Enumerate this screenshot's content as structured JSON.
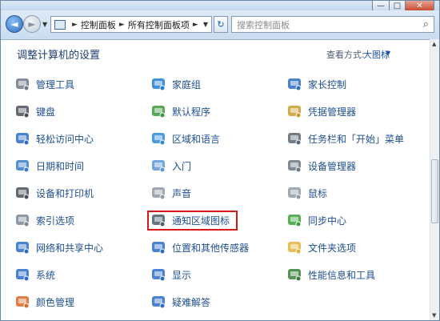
{
  "window": {
    "controls": {
      "minimize": "—",
      "maximize": "□",
      "close": "✕"
    }
  },
  "navigation": {
    "back_glyph": "◄",
    "forward_glyph": "►",
    "breadcrumb": [
      "控制面板",
      "所有控制面板项"
    ],
    "refresh_glyph": "↻",
    "search_placeholder": "搜索控制面板"
  },
  "header": {
    "title": "调整计算机的设置",
    "view_by_label": "查看方式:",
    "view_by_value": "大图标"
  },
  "items": [
    {
      "label": "管理工具",
      "icon": "admin-tools-icon",
      "color": "#6f7b88"
    },
    {
      "label": "键盘",
      "icon": "keyboard-icon",
      "color": "#4a4f57"
    },
    {
      "label": "轻松访问中心",
      "icon": "ease-of-access-icon",
      "color": "#2b6bc9"
    },
    {
      "label": "日期和时间",
      "icon": "date-time-icon",
      "color": "#3a7bc8"
    },
    {
      "label": "设备和打印机",
      "icon": "devices-printers-icon",
      "color": "#4a4f57"
    },
    {
      "label": "索引选项",
      "icon": "indexing-icon",
      "color": "#7a8794"
    },
    {
      "label": "网络和共享中心",
      "icon": "network-sharing-icon",
      "color": "#2b6bc9"
    },
    {
      "label": "系统",
      "icon": "system-icon",
      "color": "#2b6bc9"
    },
    {
      "label": "颜色管理",
      "icon": "color-management-icon",
      "color": "#d96a2b"
    },
    {
      "label": "家庭组",
      "icon": "homegroup-icon",
      "color": "#1f7fd6"
    },
    {
      "label": "默认程序",
      "icon": "default-programs-icon",
      "color": "#3a9a3a"
    },
    {
      "label": "区域和语言",
      "icon": "region-language-icon",
      "color": "#2d8ad6"
    },
    {
      "label": "入门",
      "icon": "getting-started-icon",
      "color": "#5a97d6"
    },
    {
      "label": "声音",
      "icon": "sound-icon",
      "color": "#8e99a4"
    },
    {
      "label": "通知区域图标",
      "icon": "notification-area-icon",
      "color": "#4a5a6a"
    },
    {
      "label": "位置和其他传感器",
      "icon": "location-sensors-icon",
      "color": "#2b6bc9"
    },
    {
      "label": "显示",
      "icon": "display-icon",
      "color": "#2b6bc9"
    },
    {
      "label": "疑难解答",
      "icon": "troubleshooting-icon",
      "color": "#2b6bc9"
    },
    {
      "label": "家长控制",
      "icon": "parental-controls-icon",
      "color": "#2b6bc9"
    },
    {
      "label": "凭据管理器",
      "icon": "credential-manager-icon",
      "color": "#c89b2b"
    },
    {
      "label": "任务栏和「开始」菜单",
      "icon": "taskbar-start-icon",
      "color": "#5a6670"
    },
    {
      "label": "设备管理器",
      "icon": "device-manager-icon",
      "color": "#6b7580"
    },
    {
      "label": "鼠标",
      "icon": "mouse-icon",
      "color": "#8e99a4"
    },
    {
      "label": "同步中心",
      "icon": "sync-center-icon",
      "color": "#3aa13a"
    },
    {
      "label": "文件夹选项",
      "icon": "folder-options-icon",
      "color": "#e3b23a"
    },
    {
      "label": "性能信息和工具",
      "icon": "performance-icon",
      "color": "#3a7f3a"
    }
  ]
}
